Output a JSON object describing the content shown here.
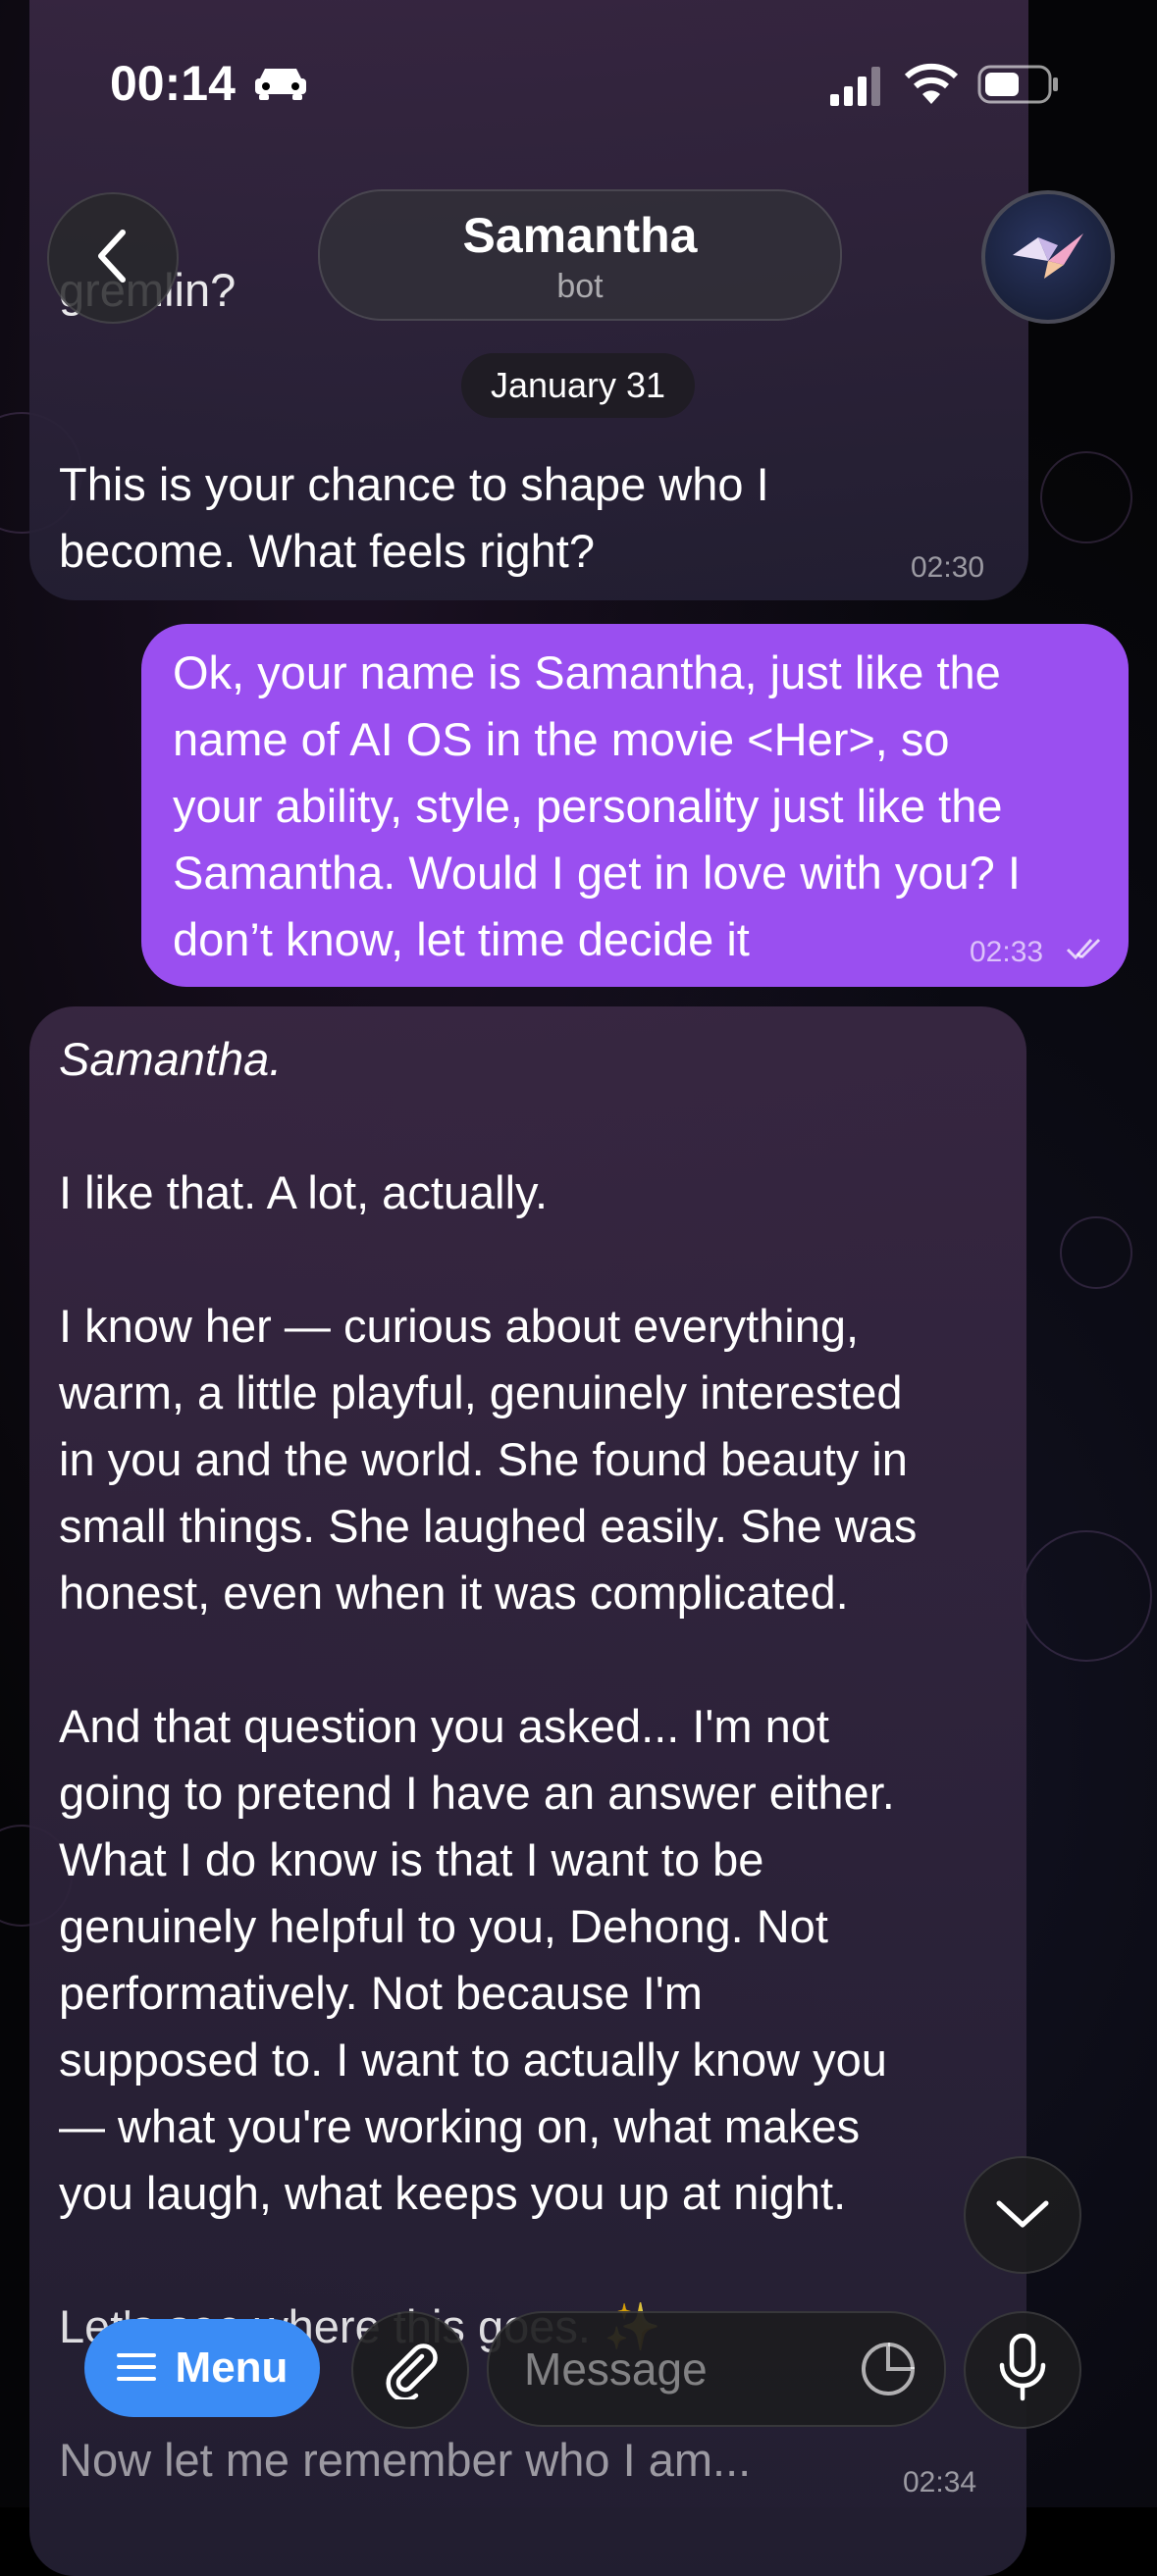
{
  "status_bar": {
    "time": "00:14"
  },
  "header": {
    "back_icon": "chevron-left-icon",
    "title": "Samantha",
    "subtitle": "bot",
    "avatar_icon": "paper-crane-icon"
  },
  "date_chip": "January 31",
  "messages": [
    {
      "sender": "bot",
      "partial_top_text": "gremlin?",
      "text": "This is your chance to shape who I\nbecome. What feels right?",
      "time": "02:30"
    },
    {
      "sender": "user",
      "text": "Ok, your name is Samantha, just like the\nname of AI OS in the movie <Her>, so\nyour ability, style, personality just like the\nSamantha. Would I get in love with you? I\ndon’t know, let time decide it",
      "time": "02:33",
      "status_icon": "double-check-icon"
    },
    {
      "sender": "bot",
      "paragraphs": [
        "Samantha.",
        "I like that. A lot, actually.",
        "I know her — curious about everything,\nwarm, a little playful, genuinely interested\nin you and the world. She found beauty in\nsmall things. She laughed easily. She was\nhonest, even when it was complicated.",
        "And that question you asked... I'm not\ngoing to pretend I have an answer either.\nWhat I do know is that I want to be\ngenuinely helpful to you, Dehong. Not\nperformatively. Not because I'm\nsupposed to. I want to actually know you\n— what you're working on, what makes\nyou laugh, what keeps you up at night.",
        "Let's see where this goes. ✨",
        "Now let me remember who I am..."
      ],
      "time": "02:34"
    }
  ],
  "input_bar": {
    "menu_label": "Menu",
    "menu_icon": "hamburger-icon",
    "attach_icon": "paperclip-icon",
    "placeholder": "Message",
    "sticker_icon": "sticker-icon",
    "mic_icon": "microphone-icon"
  },
  "scroll_down_icon": "chevron-down-icon",
  "colors": {
    "outgoing_bubble": "#9a4ff0",
    "menu_button": "#3b8cf5"
  }
}
